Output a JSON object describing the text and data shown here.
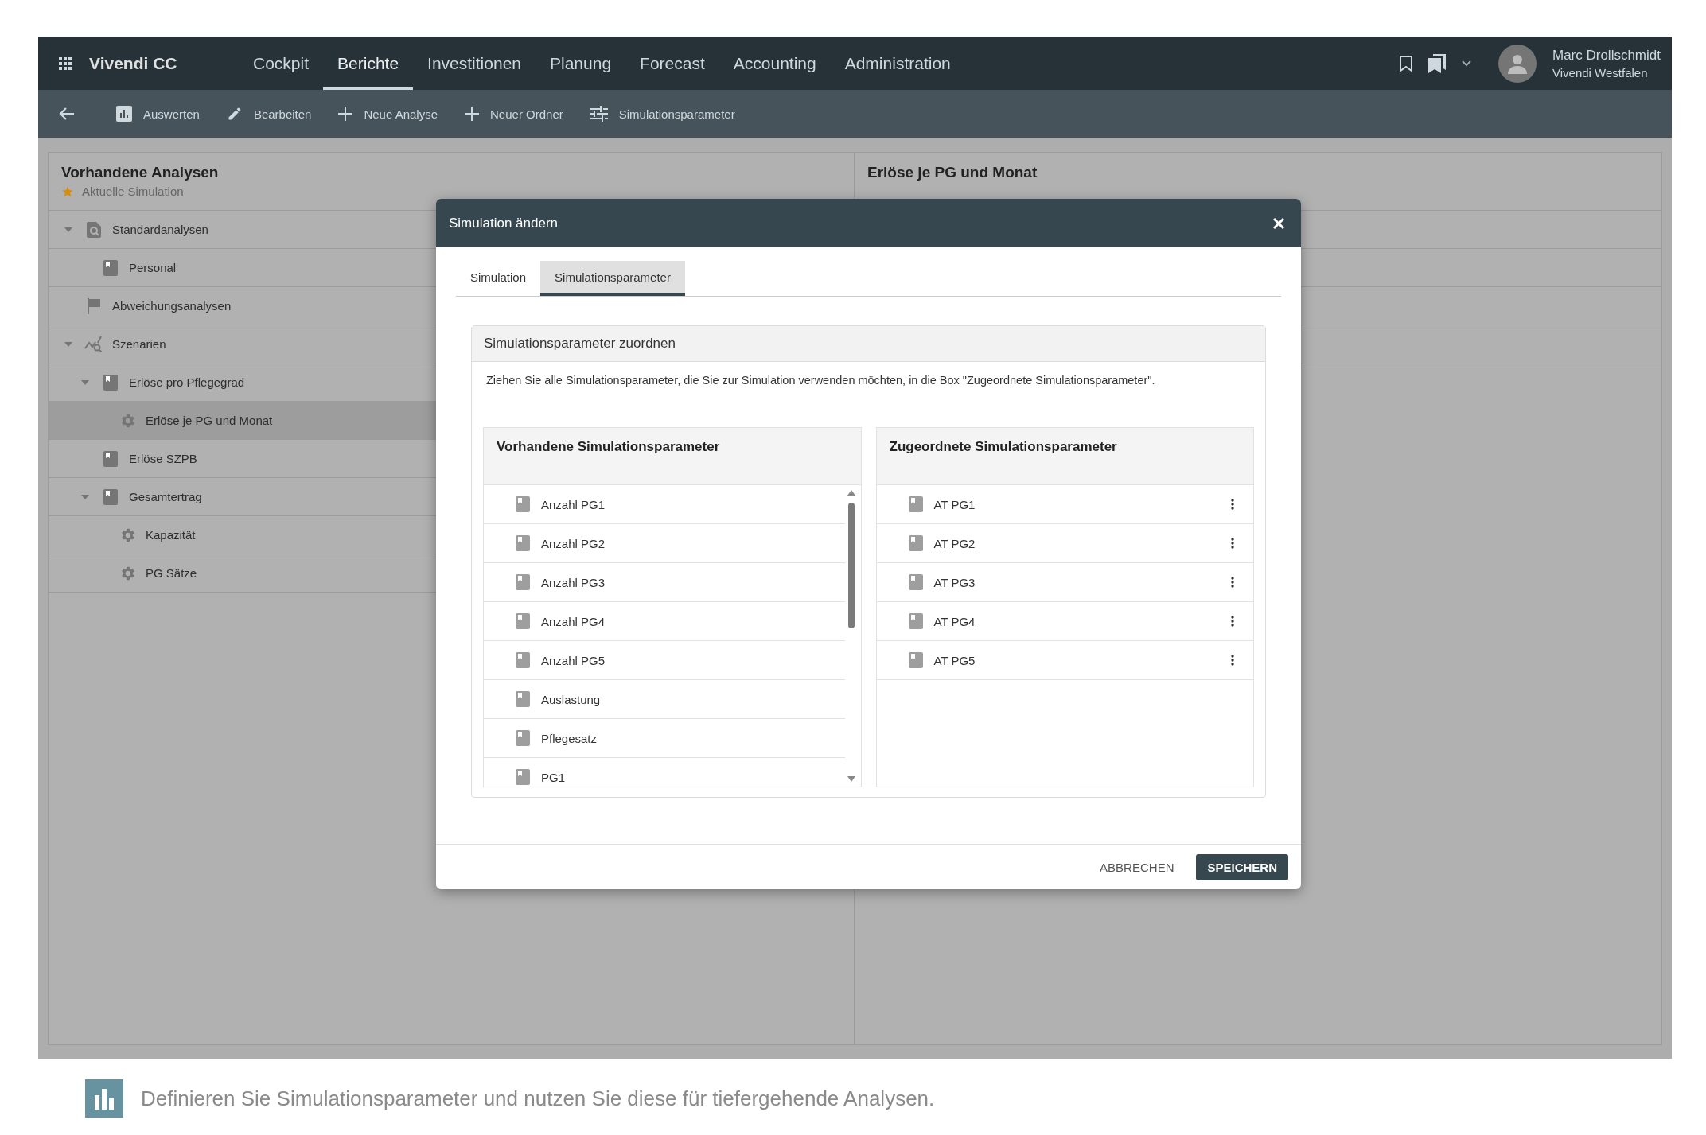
{
  "app": {
    "title": "Vivendi CC"
  },
  "nav": [
    {
      "label": "Cockpit",
      "selected": false
    },
    {
      "label": "Berichte",
      "selected": true
    },
    {
      "label": "Investitionen",
      "selected": false
    },
    {
      "label": "Planung",
      "selected": false
    },
    {
      "label": "Forecast",
      "selected": false
    },
    {
      "label": "Accounting",
      "selected": false
    },
    {
      "label": "Administration",
      "selected": false
    }
  ],
  "user": {
    "name": "Marc Drollschmidt",
    "org": "Vivendi Westfalen"
  },
  "toolbar": [
    {
      "label": "Auswerten",
      "kind": "chart"
    },
    {
      "label": "Bearbeiten",
      "kind": "edit"
    },
    {
      "label": "Neue Analyse",
      "kind": "add"
    },
    {
      "label": "Neuer Ordner",
      "kind": "add"
    },
    {
      "label": "Simulationsparameter",
      "kind": "tune"
    }
  ],
  "left_panel": {
    "title": "Vorhandene Analysen",
    "subtitle": "Aktuelle Simulation",
    "tree": [
      {
        "label": "Standardanalysen",
        "kind": "search",
        "selected": false,
        "expanded": true,
        "children": [
          {
            "label": "Personal",
            "kind": "report",
            "selected": false
          }
        ]
      },
      {
        "label": "Abweichungsanalysen",
        "kind": "flag",
        "selected": false
      },
      {
        "label": "Szenarien",
        "kind": "scenario",
        "selected": false,
        "expanded": true,
        "children": [
          {
            "label": "Erlöse pro Pflegegrad",
            "kind": "report",
            "selected": false,
            "expanded": true,
            "children": [
              {
                "label": "Erlöse je PG und Monat",
                "kind": "gear",
                "selected": true
              }
            ]
          },
          {
            "label": "Erlöse SZPB",
            "kind": "report",
            "selected": false
          },
          {
            "label": "Gesamtertrag",
            "kind": "report",
            "selected": false,
            "expanded": true,
            "children": [
              {
                "label": "Kapazität",
                "kind": "gear",
                "selected": false
              },
              {
                "label": "PG Sätze",
                "kind": "gear",
                "selected": false
              }
            ]
          }
        ]
      }
    ]
  },
  "right_panel": {
    "title": "Erlöse je PG und Monat"
  },
  "dialog": {
    "title": "Simulation ändern",
    "tabs": [
      {
        "label": "Simulation",
        "selected": false
      },
      {
        "label": "Simulationsparameter",
        "selected": true
      }
    ],
    "section_title": "Simulationsparameter zuordnen",
    "description": "Ziehen Sie alle Simulationsparameter, die Sie zur Simulation verwenden möchten, in die Box \"Zugeordnete Simulationsparameter\".",
    "available": {
      "title": "Vorhandene Simulationsparameter",
      "items": [
        "Anzahl PG1",
        "Anzahl PG2",
        "Anzahl PG3",
        "Anzahl PG4",
        "Anzahl PG5",
        "Auslastung",
        "Pflegesatz",
        "PG1"
      ]
    },
    "assigned": {
      "title": "Zugeordnete Simulationsparameter",
      "items": [
        "AT PG1",
        "AT PG2",
        "AT PG3",
        "AT PG4",
        "AT PG5"
      ]
    },
    "buttons": [
      {
        "label": "ABBRECHEN",
        "kind": "text"
      },
      {
        "label": "SPEICHERN",
        "kind": "primary"
      }
    ]
  },
  "caption": "Definieren Sie Simulationsparameter und nutzen Sie diese für tiefergehende Analysen."
}
